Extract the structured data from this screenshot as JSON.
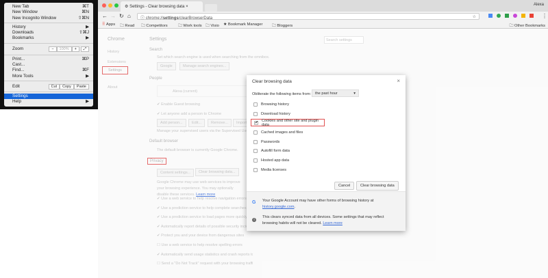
{
  "menu": {
    "items": [
      {
        "label": "New Tab",
        "shortcut": "⌘T"
      },
      {
        "label": "New Window",
        "shortcut": "⌘N"
      },
      {
        "label": "New Incognito Window",
        "shortcut": "⇧⌘N"
      },
      {
        "label": "History",
        "shortcut": "▶"
      },
      {
        "label": "Downloads",
        "shortcut": "⇧⌘J"
      },
      {
        "label": "Bookmarks",
        "shortcut": "▶"
      },
      {
        "label": "Print...",
        "shortcut": "⌘P"
      },
      {
        "label": "Cast...",
        "shortcut": ""
      },
      {
        "label": "Find...",
        "shortcut": "⌘F"
      },
      {
        "label": "More Tools",
        "shortcut": "▶"
      },
      {
        "label": "Settings",
        "shortcut": ""
      },
      {
        "label": "Help",
        "shortcut": "▶"
      }
    ],
    "zoom_label": "Zoom",
    "zoom_value": "100%",
    "zoom_minus": "−",
    "zoom_plus": "+",
    "edit_label": "Edit",
    "cut": "Cut",
    "copy": "Copy",
    "paste": "Paste"
  },
  "browser": {
    "tab_title": "Settings - Clear browsing data",
    "tab_close": "×",
    "user": "Alexa",
    "url_prefix": "chrome://",
    "url_bold": "settings",
    "url_rest": "/clearBrowserData",
    "bookmarks": [
      "Apps",
      "Read",
      "Competitors",
      "Work tools",
      "Visio",
      "Bookmark Manager",
      "Bloggers"
    ],
    "other_bookmarks": "Other Bookmarks"
  },
  "settings": {
    "brand": "Chrome",
    "nav": [
      "History",
      "Extensions",
      "Settings",
      "About"
    ],
    "title": "Settings",
    "search_placeholder": "Search settings",
    "search_heading": "Search",
    "search_desc": "Set which search engine is used when searching from the omnibox.",
    "engine": "Google",
    "manage_engines": "Manage search engines...",
    "people_heading": "People",
    "person": "Alexa (current)",
    "guest": "Enable Guest browsing",
    "add_anyone": "Let anyone add a person to Chrome",
    "people_buttons": [
      "Add person...",
      "Edit...",
      "Remove...",
      "Import..."
    ],
    "supervised": "Manage your supervised users via the Supervised Users Dashboard",
    "default_heading": "Default browser",
    "default_desc": "The default browser is currently Google Chrome.",
    "privacy_heading": "Privacy",
    "content_settings": "Content settings...",
    "clear_data": "Clear browsing data...",
    "privacy_desc": "Google Chrome may use web services to improve your browsing experience. You may optionally disable these services.",
    "learn_more": "Learn more",
    "privacy_items": [
      {
        "label": "Use a web service to help resolve navigation errors",
        "checked": true
      },
      {
        "label": "Use a prediction service to help complete searches and URLs typed in the address bar",
        "checked": true
      },
      {
        "label": "Use a prediction service to load pages more quickly",
        "checked": true
      },
      {
        "label": "Automatically report details of possible security incidents to Google",
        "checked": true
      },
      {
        "label": "Protect you and your device from dangerous sites",
        "checked": true
      },
      {
        "label": "Use a web service to help resolve spelling errors",
        "checked": false
      },
      {
        "label": "Automatically send usage statistics and crash reports to Google",
        "checked": true
      },
      {
        "label": "Send a \"Do Not Track\" request with your browsing traffic",
        "checked": false
      }
    ]
  },
  "dialog": {
    "title": "Clear browsing data",
    "close": "×",
    "obliterate_label": "Obliterate the following items from:",
    "period": "the past hour",
    "items": [
      {
        "label": "Browsing history",
        "checked": false
      },
      {
        "label": "Download history",
        "checked": false
      },
      {
        "label": "Cookies and other site and plugin data",
        "checked": true
      },
      {
        "label": "Cached images and files",
        "checked": false
      },
      {
        "label": "Passwords",
        "checked": false
      },
      {
        "label": "Autofill form data",
        "checked": false
      },
      {
        "label": "Hosted app data",
        "checked": false
      },
      {
        "label": "Media licenses",
        "checked": false
      }
    ],
    "cancel": "Cancel",
    "confirm": "Clear browsing data",
    "footer1": "Your Google Account may have other forms of browsing history at",
    "footer1_link": "history.google.com",
    "footer1_end": ".",
    "footer2": "This clears synced data from all devices. Some settings that may reflect browsing habits will not be cleared.",
    "footer2_link": "Learn more"
  }
}
